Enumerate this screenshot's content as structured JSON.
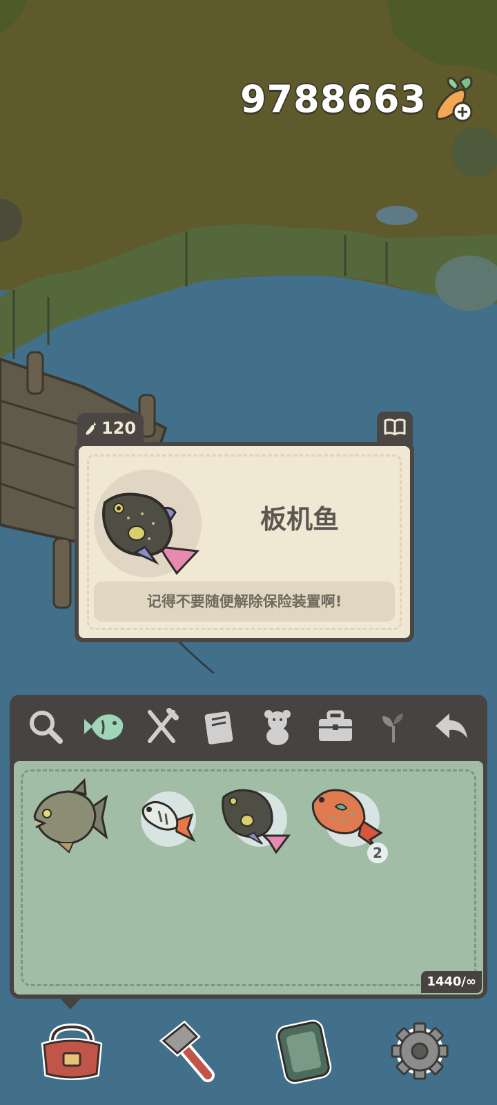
{
  "currency": {
    "value": "9788663",
    "icon": "carrot-plus-icon"
  },
  "fish_card": {
    "price": "120",
    "price_icon": "carrot-icon",
    "name": "板机鱼",
    "description": "记得不要随便解除保险装置啊!",
    "book_icon": "open-book-icon"
  },
  "toolbar": {
    "items": [
      {
        "name": "search",
        "icon": "magnifier-icon",
        "active": false
      },
      {
        "name": "fish",
        "icon": "fish-icon",
        "active": true
      },
      {
        "name": "food",
        "icon": "fork-knife-icon",
        "active": false
      },
      {
        "name": "books",
        "icon": "book-icon",
        "active": false
      },
      {
        "name": "toys",
        "icon": "teddy-bear-icon",
        "active": false
      },
      {
        "name": "tools",
        "icon": "toolbox-icon",
        "active": false
      },
      {
        "name": "plants",
        "icon": "sprout-icon",
        "active": false
      },
      {
        "name": "back",
        "icon": "back-arrow-icon",
        "active": false
      }
    ]
  },
  "inventory": {
    "items": [
      {
        "name": "piranha",
        "count": ""
      },
      {
        "name": "small-fish",
        "count": ""
      },
      {
        "name": "triggerfish",
        "count": ""
      },
      {
        "name": "parrotfish",
        "count": "2"
      }
    ],
    "capacity": "1440/∞"
  },
  "bottom_nav": [
    {
      "name": "bag",
      "icon": "bag-icon"
    },
    {
      "name": "build",
      "icon": "hammer-icon"
    },
    {
      "name": "phone",
      "icon": "phone-icon"
    },
    {
      "name": "settings",
      "icon": "gear-icon"
    }
  ],
  "colors": {
    "panel": "#464340",
    "card": "#f1e8d3",
    "grid": "#a1bda6",
    "active_tool": "#9fd6b8",
    "inactive_tool": "#cfcfcf"
  }
}
